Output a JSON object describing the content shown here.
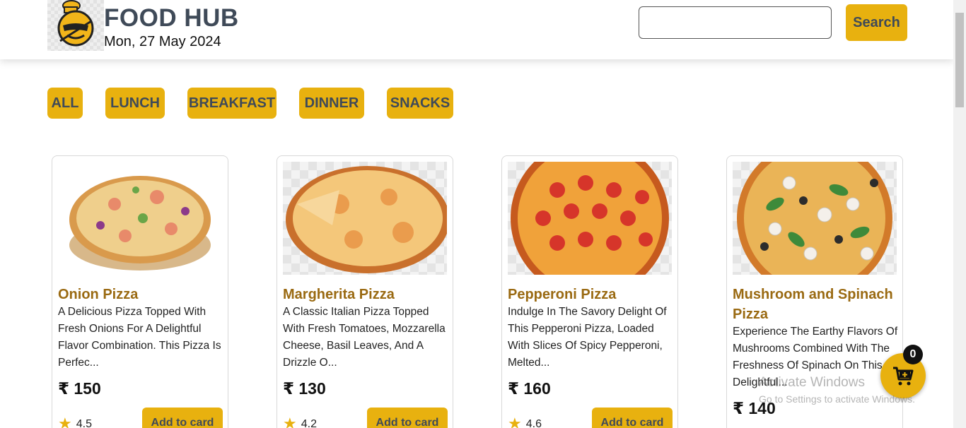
{
  "header": {
    "brand": "FOOD HUB",
    "date": "Mon, 27 May 2024",
    "search_placeholder": "",
    "search_label": "Search"
  },
  "categories": [
    "ALL",
    "LUNCH",
    "BREAKFAST",
    "DINNER",
    "SNACKS"
  ],
  "currency": "₹",
  "products": [
    {
      "name": "Onion Pizza",
      "description": "A Delicious Pizza Topped With Fresh Onions For A Delightful Flavor Combination. This Pizza Is Perfec...",
      "price": "₹ 150",
      "rating": "4.5",
      "button": "Add to card"
    },
    {
      "name": "Margherita Pizza",
      "description": "A Classic Italian Pizza Topped With Fresh Tomatoes, Mozzarella Cheese, Basil Leaves, And A Drizzle O...",
      "price": "₹ 130",
      "rating": "4.2",
      "button": "Add to card"
    },
    {
      "name": "Pepperoni Pizza",
      "description": "Indulge In The Savory Delight Of This Pepperoni Pizza, Loaded With Slices Of Spicy Pepperoni, Melted...",
      "price": "₹ 160",
      "rating": "4.6",
      "button": "Add to card"
    },
    {
      "name": "Mushroom and Spinach Pizza",
      "description": "Experience The Earthy Flavors Of Mushrooms Combined With The Freshness Of Spinach On This Delightful...",
      "price": "₹ 140",
      "rating": "",
      "button": ""
    }
  ],
  "cart": {
    "count": "0",
    "icon": "cart-icon"
  },
  "watermark": {
    "line1": "Activate Windows",
    "line2": "Go to Settings to activate Windows."
  },
  "colors": {
    "accent": "#e8b10f",
    "title": "#9a6a12",
    "brand": "#3f4a58"
  }
}
